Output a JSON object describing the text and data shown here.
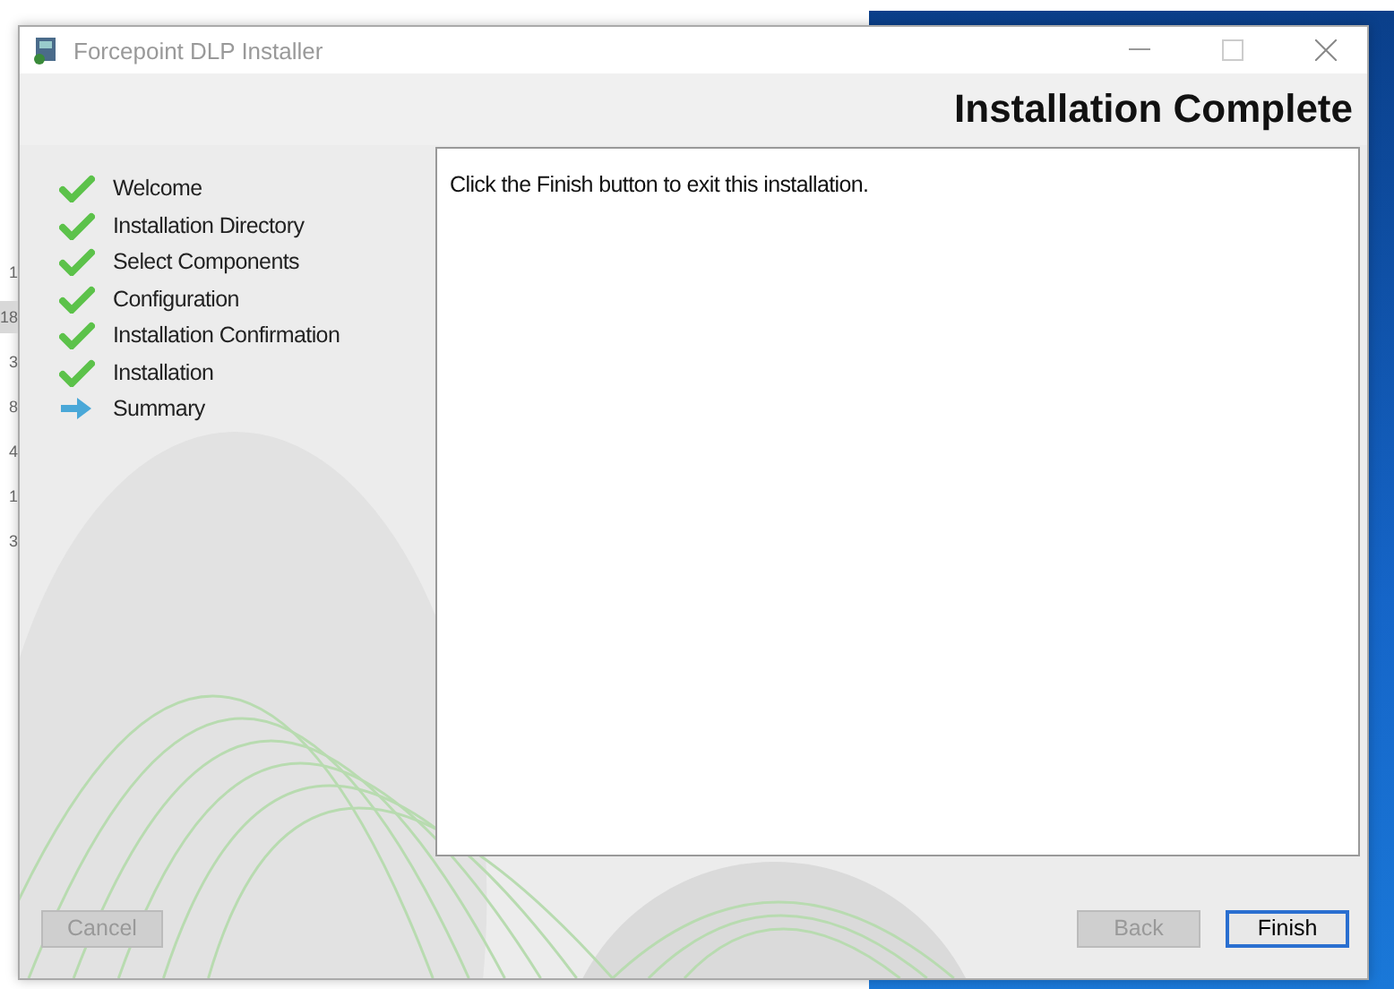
{
  "background": {
    "row_fragments": [
      {
        "text": "1",
        "selected": false
      },
      {
        "text": "18",
        "selected": true
      },
      {
        "text": "3",
        "selected": false
      },
      {
        "text": "8",
        "selected": false
      },
      {
        "text": "4",
        "selected": false
      },
      {
        "text": "1",
        "selected": false
      },
      {
        "text": "3",
        "selected": false
      }
    ]
  },
  "window": {
    "title": "Forcepoint DLP Installer",
    "heading": "Installation Complete"
  },
  "steps": [
    {
      "label": "Welcome",
      "kind": "done"
    },
    {
      "label": "Installation Directory",
      "kind": "done"
    },
    {
      "label": "Select Components",
      "kind": "done"
    },
    {
      "label": "Configuration",
      "kind": "done"
    },
    {
      "label": "Installation Confirmation",
      "kind": "done"
    },
    {
      "label": "Installation",
      "kind": "done"
    },
    {
      "label": "Summary",
      "kind": "current"
    }
  ],
  "message": "Click the Finish button to exit this installation.",
  "left_buttons": [
    {
      "label": "Cancel",
      "disabled": true,
      "default": false
    }
  ],
  "right_buttons": [
    {
      "label": "Back",
      "disabled": true,
      "default": false
    },
    {
      "label": "Finish",
      "disabled": false,
      "default": true
    }
  ]
}
